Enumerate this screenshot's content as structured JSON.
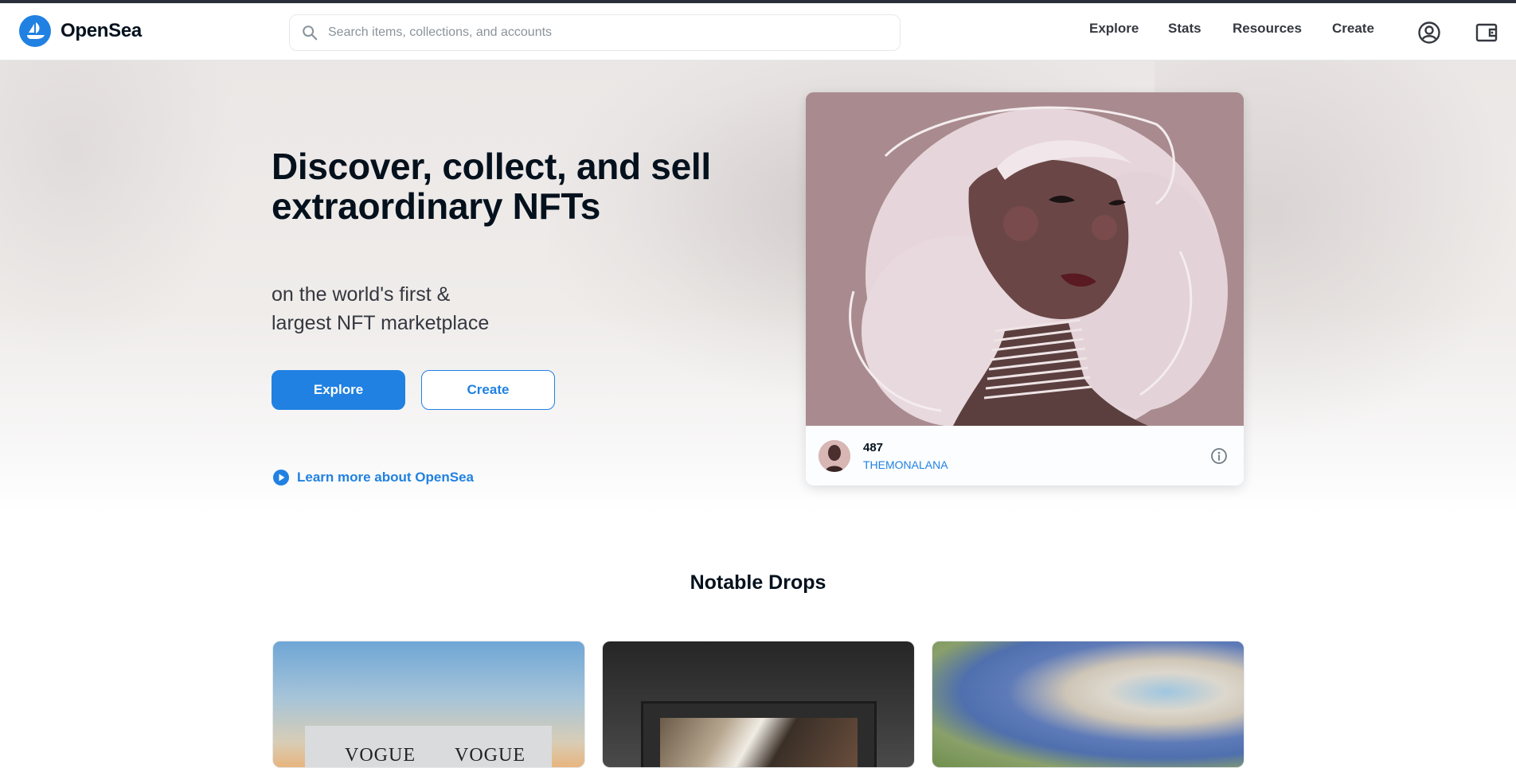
{
  "app": {
    "name": "OpenSea"
  },
  "header": {
    "search_placeholder": "Search items, collections, and accounts",
    "nav": [
      {
        "label": "Explore"
      },
      {
        "label": "Stats"
      },
      {
        "label": "Resources"
      },
      {
        "label": "Create"
      }
    ],
    "icons": [
      "account-icon",
      "wallet-icon"
    ]
  },
  "hero": {
    "headline": "Discover, collect, and sell extraordinary NFTs",
    "subline_1": "on the world's first &",
    "subline_2": "largest NFT marketplace",
    "explore_label": "Explore",
    "create_label": "Create",
    "learn_more": "Learn more about OpenSea",
    "featured": {
      "name": "487",
      "creator": "THEMONALANA"
    }
  },
  "notable_drops": {
    "title": "Notable Drops",
    "cards": [
      {
        "text_left": "VOGUE",
        "text_right": "VOGUE"
      },
      {},
      {}
    ]
  },
  "colors": {
    "brand": "#2081e2",
    "text": "#04111d",
    "muted": "#8a939b"
  }
}
